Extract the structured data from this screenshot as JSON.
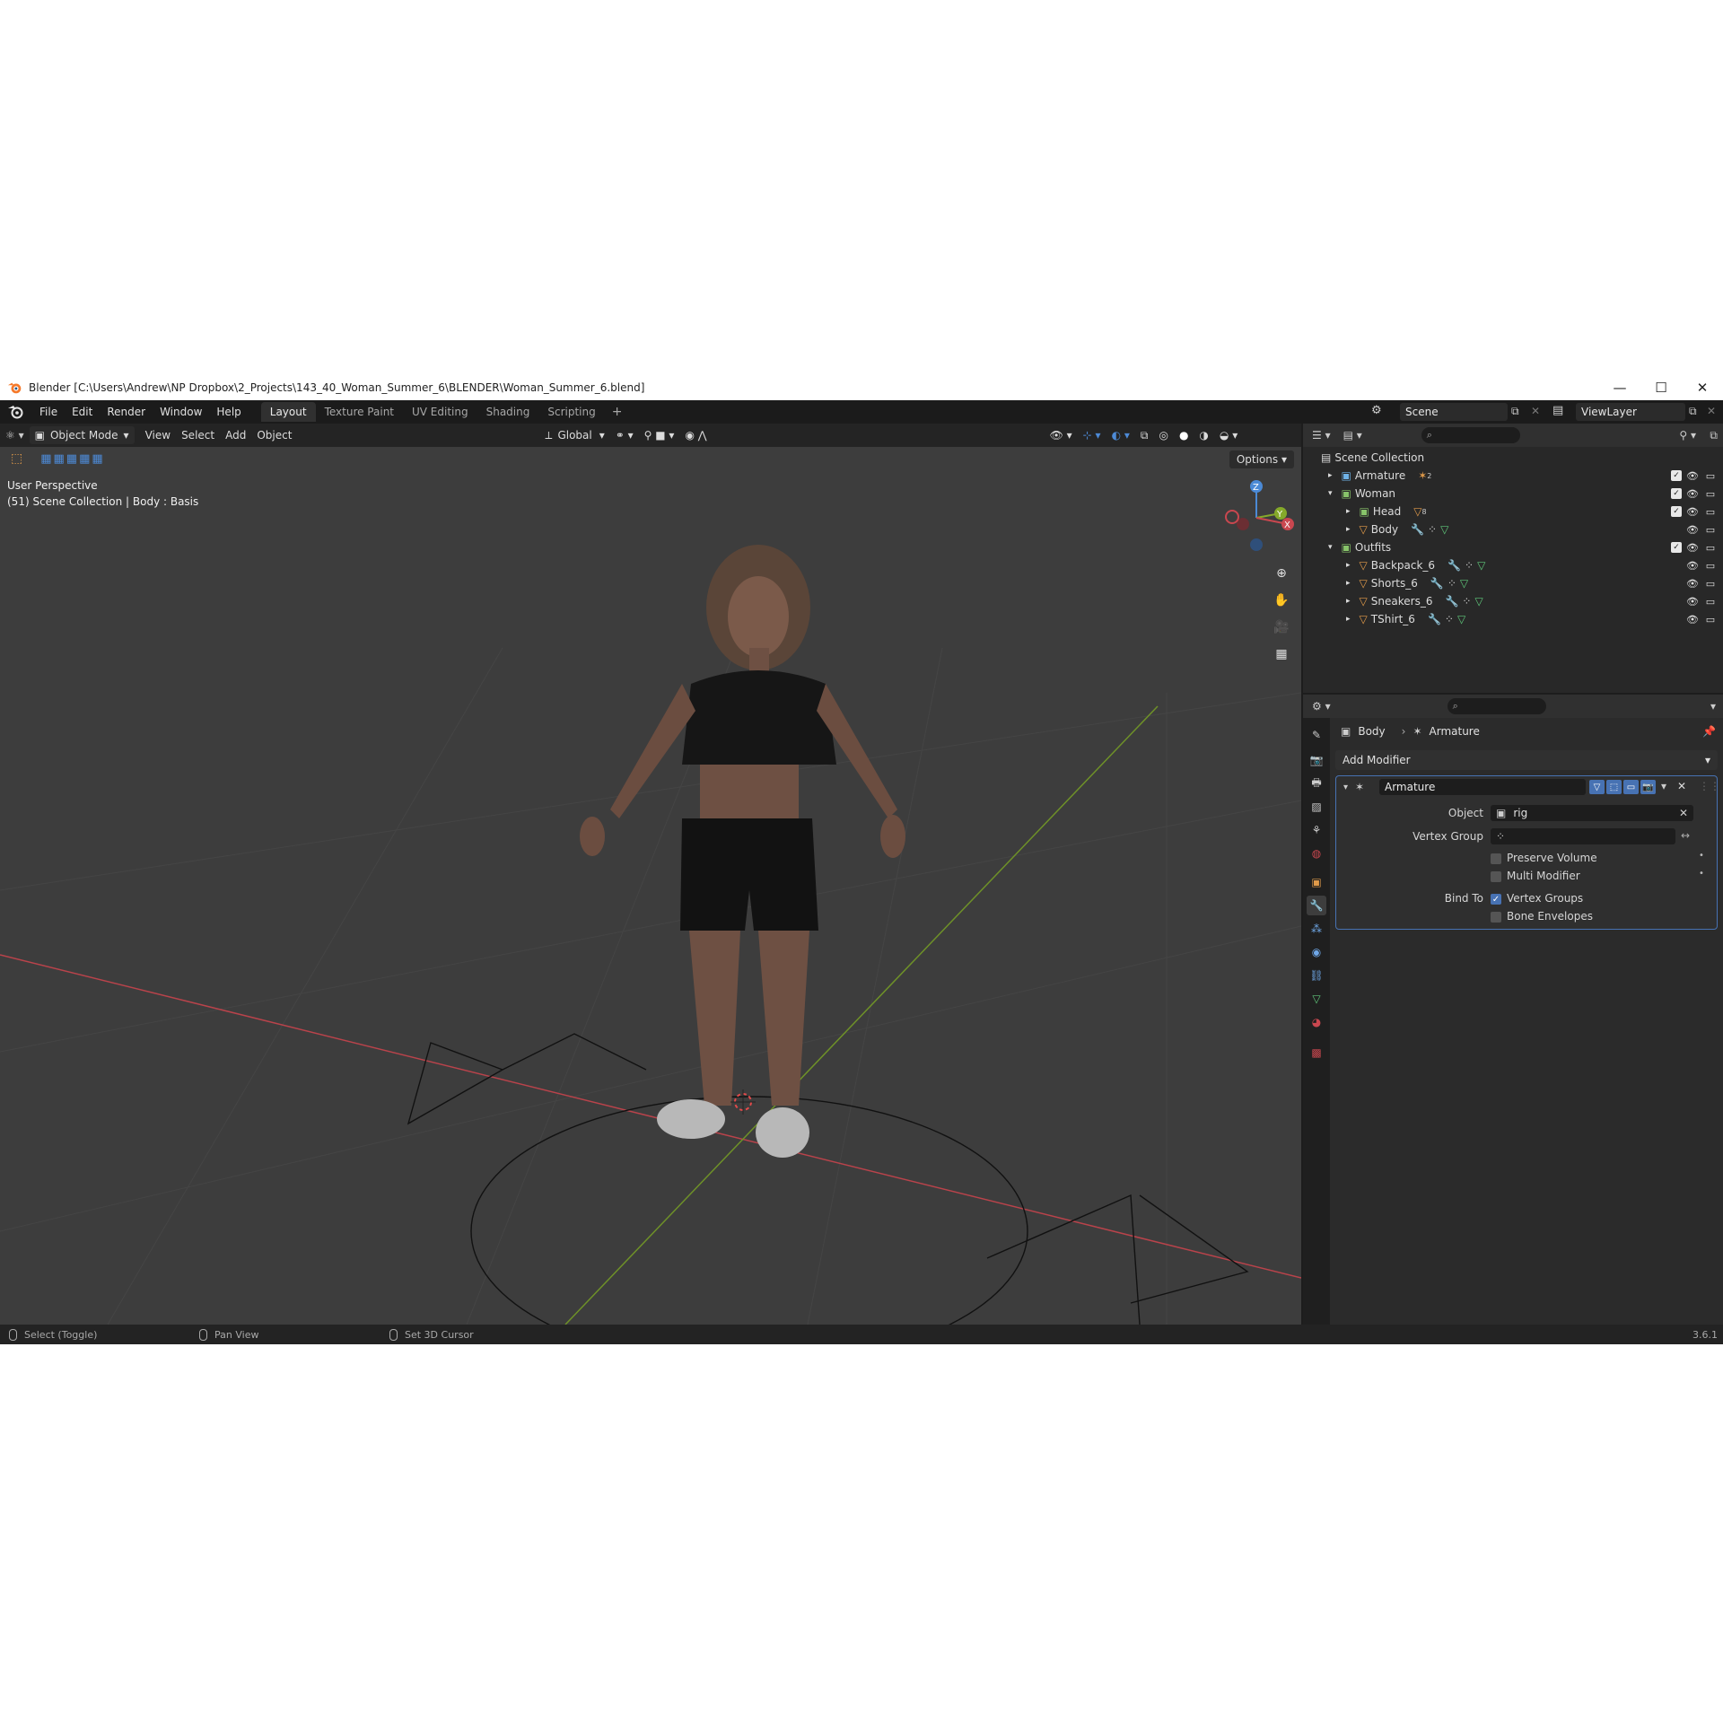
{
  "window": {
    "title": "Blender [C:\\Users\\Andrew\\NP Dropbox\\2_Projects\\143_40_Woman_Summer_6\\BLENDER\\Woman_Summer_6.blend]",
    "minimize": "—",
    "maximize": "☐",
    "close": "✕"
  },
  "menu": {
    "items": [
      "File",
      "Edit",
      "Render",
      "Window",
      "Help"
    ],
    "workspaces": [
      "Layout",
      "Texture Paint",
      "UV Editing",
      "Shading",
      "Scripting"
    ],
    "add_workspace": "+",
    "scene": "Scene",
    "view_layer": "ViewLayer"
  },
  "viewport": {
    "mode": "Object Mode",
    "menus": [
      "View",
      "Select",
      "Add",
      "Object"
    ],
    "transform_orientation": "Global",
    "options": "Options",
    "perspective": "User Perspective",
    "collection_info": "(51) Scene Collection | Body : Basis",
    "gizmo_axes": {
      "x": "X",
      "y": "Y",
      "z": "Z"
    }
  },
  "outliner": {
    "root": "Scene Collection",
    "rows": [
      {
        "label": "Armature",
        "level": 1,
        "kind": "collection",
        "badge": "2"
      },
      {
        "label": "Woman",
        "level": 1,
        "kind": "collection",
        "badge": ""
      },
      {
        "label": "Head",
        "level": 2,
        "kind": "collection",
        "badge": "8"
      },
      {
        "label": "Body",
        "level": 2,
        "kind": "mesh",
        "badge": ""
      },
      {
        "label": "Outfits",
        "level": 1,
        "kind": "collection",
        "badge": ""
      },
      {
        "label": "Backpack_6",
        "level": 2,
        "kind": "mesh",
        "badge": ""
      },
      {
        "label": "Shorts_6",
        "level": 2,
        "kind": "mesh",
        "badge": ""
      },
      {
        "label": "Sneakers_6",
        "level": 2,
        "kind": "mesh",
        "badge": ""
      },
      {
        "label": "TShirt_6",
        "level": 2,
        "kind": "mesh",
        "badge": ""
      }
    ]
  },
  "properties": {
    "breadcrumb_object": "Body",
    "breadcrumb_modifier": "Armature",
    "add_modifier": "Add Modifier",
    "modifier": {
      "name": "Armature",
      "object_label": "Object",
      "object_value": "rig",
      "vertex_group_label": "Vertex Group",
      "vertex_group_value": "",
      "preserve_volume": "Preserve Volume",
      "multi_modifier": "Multi Modifier",
      "bind_to_label": "Bind To",
      "vertex_groups": "Vertex Groups",
      "bone_envelopes": "Bone Envelopes"
    }
  },
  "status": {
    "select": "Select (Toggle)",
    "pan": "Pan View",
    "cursor": "Set 3D Cursor",
    "version": "3.6.1"
  },
  "colors": {
    "accent": "#4772b3",
    "x_axis": "#c9474f",
    "y_axis": "#85a92a",
    "z_axis": "#4b8ad6",
    "collection": "#e6e6e6",
    "mesh": "#e09a4a",
    "viewport_bg": "#3d3d3d"
  }
}
